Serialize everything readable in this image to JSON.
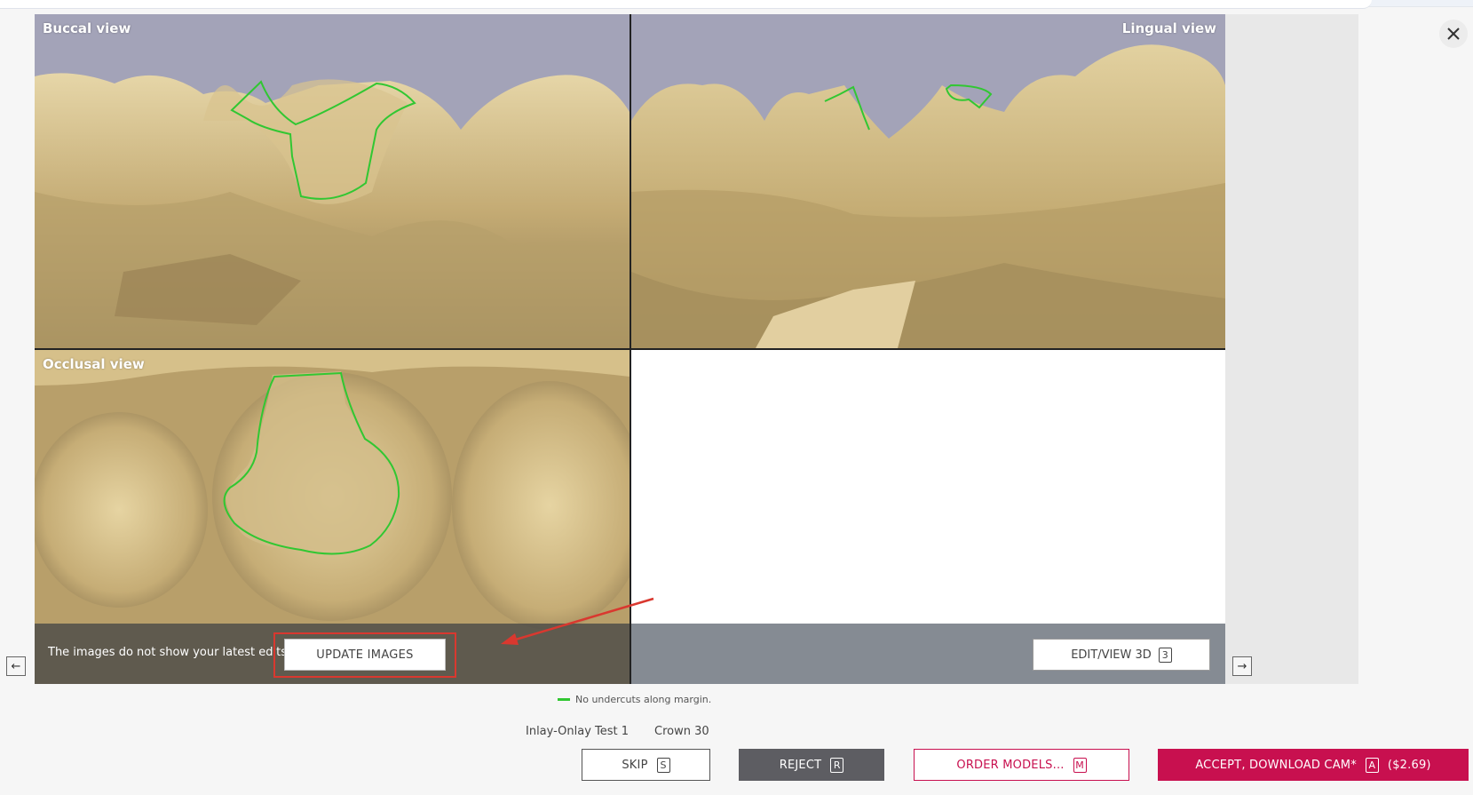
{
  "viewer": {
    "views": {
      "buccal": "Buccal view",
      "lingual": "Lingual view",
      "occlusal": "Occlusal view"
    },
    "edits_message": "The images do not show your latest edits.",
    "update_images_label": "UPDATE IMAGES",
    "edit_view_3d_label": "EDIT/VIEW 3D",
    "edit_view_3d_key": "3",
    "legend_text": "No undercuts along margin.",
    "nav_left_icon": "arrow-left-icon",
    "nav_right_icon": "arrow-right-icon"
  },
  "case": {
    "name": "Inlay-Onlay Test 1",
    "type": "Crown 30"
  },
  "actions": {
    "skip": {
      "label": "SKIP",
      "key": "S"
    },
    "reject": {
      "label": "REJECT",
      "key": "R"
    },
    "order_models": {
      "label": "ORDER MODELS...",
      "key": "M"
    },
    "accept": {
      "label": "ACCEPT, DOWNLOAD CAM*",
      "key": "A",
      "price": "($2.69)"
    }
  },
  "colors": {
    "accent": "#c8104f",
    "margin_line": "#31c732",
    "tooth": "#c9b27e",
    "sky": "#a3a3b8",
    "highlight": "#d9382f"
  }
}
